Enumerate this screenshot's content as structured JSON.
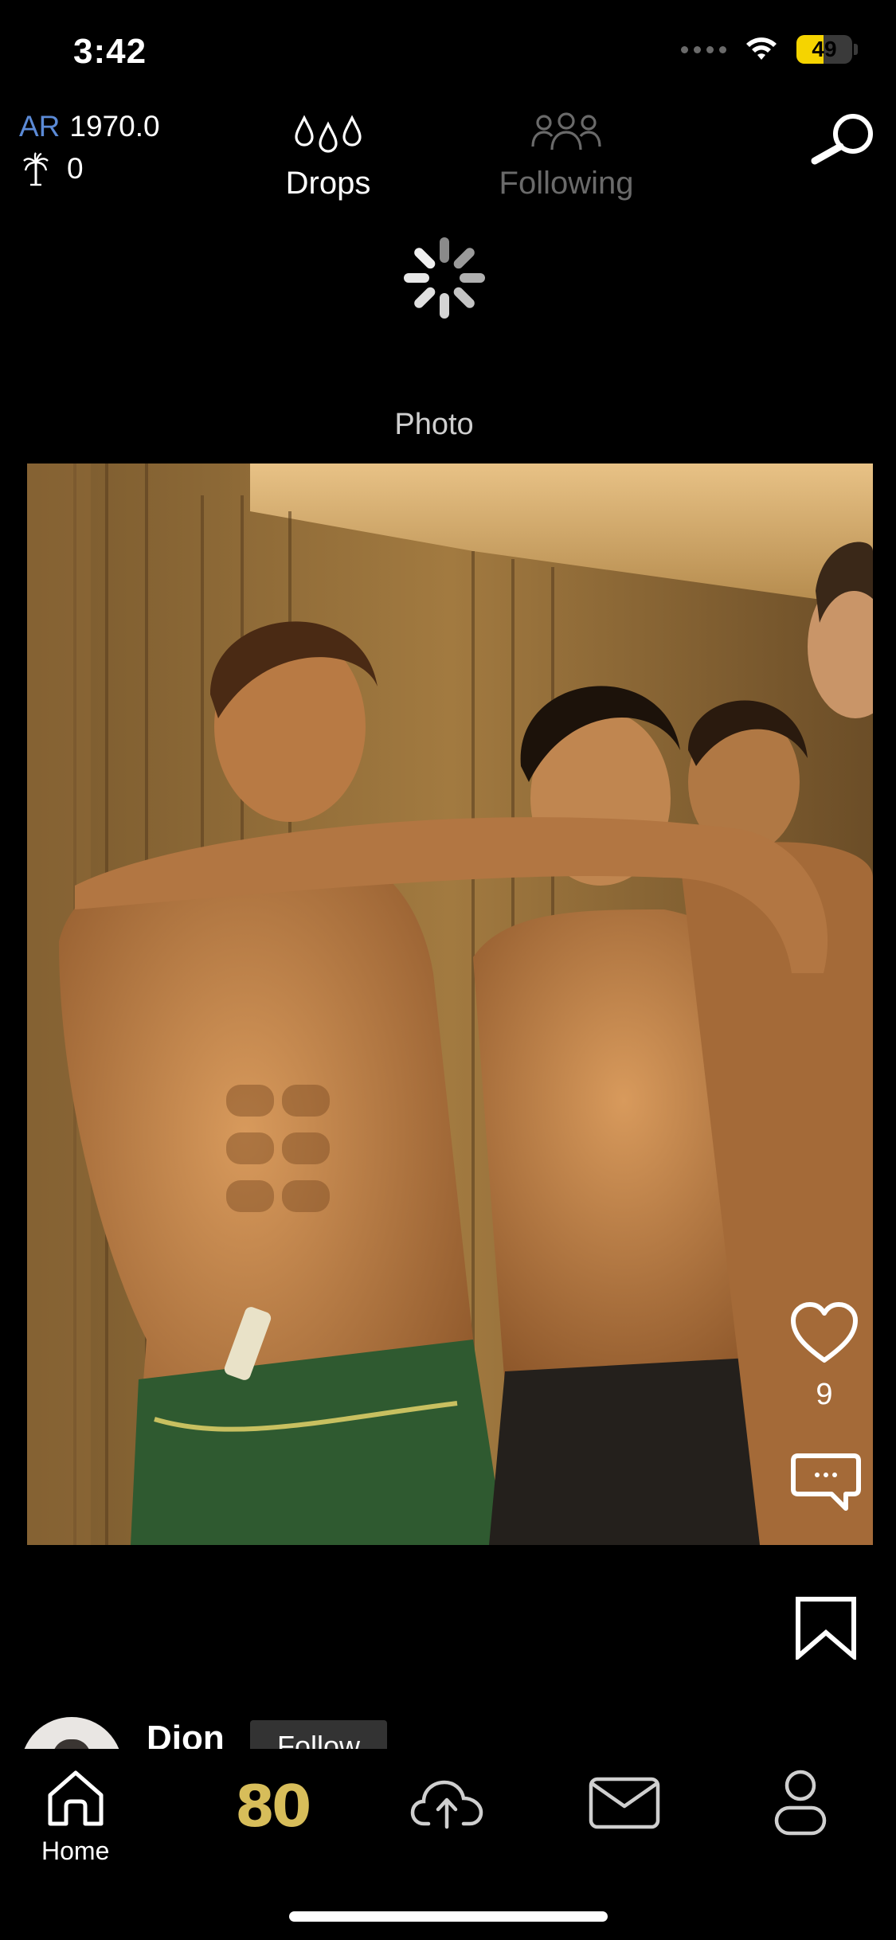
{
  "status_bar": {
    "time": "3:42",
    "battery": "49",
    "battery_level": 0.49
  },
  "header": {
    "ar_label": "AR",
    "ar_value": "1970.0",
    "palm_value": "0",
    "tabs": [
      {
        "label": "Drops",
        "active": true
      },
      {
        "label": "Following",
        "active": false
      }
    ]
  },
  "feed": {
    "type_label": "Photo",
    "likes": "9",
    "author": {
      "name": "Dion",
      "follow_label": "Follow"
    }
  },
  "bottom_nav": {
    "home_label": "Home",
    "center_label": "80",
    "accent_color": "#d7bd5a"
  },
  "icons": [
    "drops-icon",
    "following-icon",
    "search-icon",
    "loading-spinner-icon",
    "heart-icon",
    "comment-icon",
    "bookmark-icon",
    "home-icon",
    "upload-cloud-icon",
    "mail-icon",
    "profile-icon",
    "palm-tree-icon",
    "wifi-icon"
  ]
}
